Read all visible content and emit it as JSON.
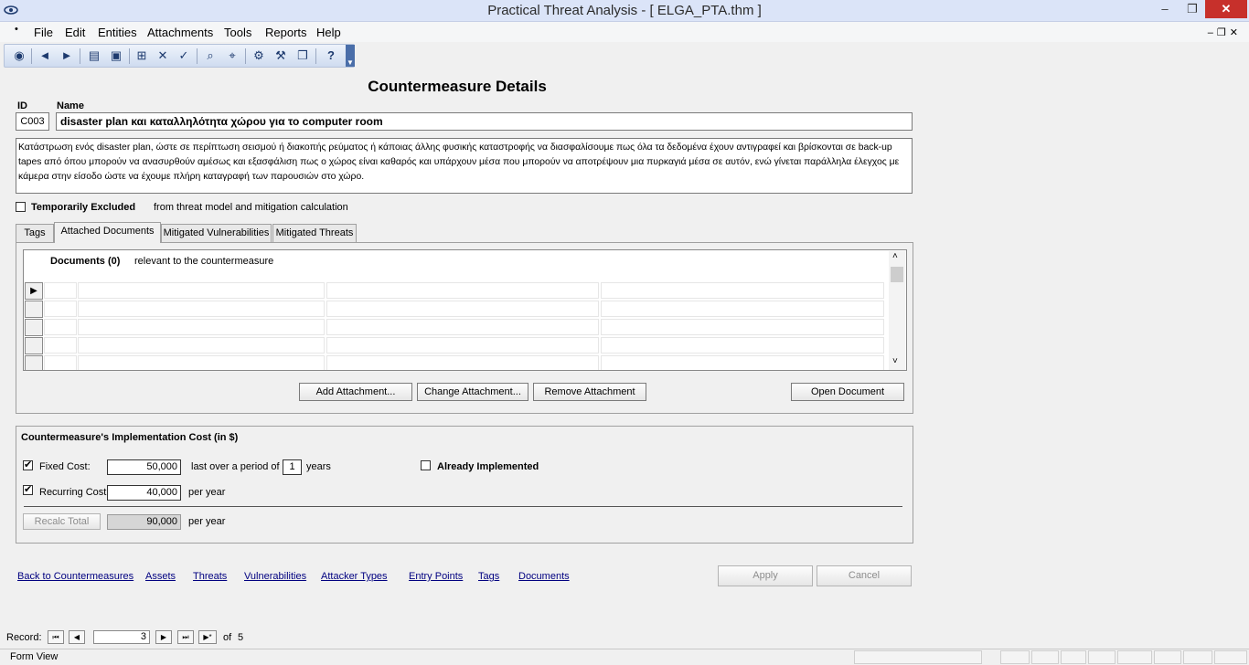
{
  "window": {
    "title": "Practical Threat Analysis - [ ELGA_PTA.thm ]",
    "minimize": "–",
    "maximize": "❐",
    "close": "✕"
  },
  "menu": {
    "grip": "•",
    "items": [
      "File",
      "Edit",
      "Entities",
      "Attachments",
      "Tools",
      "Reports",
      "Help"
    ],
    "mdi_buttons": "–❐✕"
  },
  "toolbar": {
    "icons": [
      "eye-icon",
      "back-icon",
      "forward-icon",
      "open-icon",
      "save-icon",
      "new-icon",
      "delete-icon",
      "spellcheck-icon",
      "find-icon",
      "find-replace-icon",
      "properties-icon",
      "tools-icon",
      "copy-icon",
      "help-icon"
    ]
  },
  "form": {
    "title": "Countermeasure Details",
    "id_label": "ID",
    "name_label": "Name",
    "id_value": "C003",
    "name_value": "disaster plan και καταλληλότητα χώρου για το  computer room",
    "description": "Κατάστρωση ενός disaster plan, ώστε σε περίπτωση σεισμού ή διακοπής ρεύματος ή κάποιας άλλης φυσικής καταστροφής να διασφαλίσουμε πως όλα τα δεδομένα έχουν αντιγραφεί και βρίσκονται σε back-up tapes από όπου μπορούν να ανασυρθούν αμέσως και εξασφάλιση πως ο χώρος είναι καθαρός και  υπάρχουν μέσα που μπορούν να αποτρέψουν μια πυρκαγιά μέσα σε αυτόν, ενώ γίνεται παράλληλα έλεγχος με κάμερα στην είσοδο ώστε να έχουμε πλήρη καταγραφή των παρουσιών στο χώρο.",
    "temporarily_excluded_label": "Temporarily Excluded",
    "temporarily_excluded_note": "from threat model and mitigation calculation",
    "temporarily_excluded_checked": false
  },
  "tabs": [
    {
      "label": "Tags",
      "active": false
    },
    {
      "label": "Attached Documents",
      "active": true
    },
    {
      "label": "Mitigated Vulnerabilities",
      "active": false
    },
    {
      "label": "Mitigated Threats",
      "active": false
    }
  ],
  "documents": {
    "heading": "Documents (0)",
    "subheading": "relevant to the countermeasure",
    "current_row_marker": "▶",
    "buttons": {
      "add": "Add Attachment...",
      "change": "Change Attachment...",
      "remove": "Remove Attachment",
      "open": "Open Document"
    },
    "scroll_up": "˄",
    "scroll_down": "˅"
  },
  "cost": {
    "title": "Countermeasure's Implementation Cost (in $)",
    "fixed_label": "Fixed Cost:",
    "fixed_checked": true,
    "fixed_value": "50,000",
    "period_prefix": "last over a period of",
    "period_value": "1",
    "period_suffix": "years",
    "already_implemented_label": "Already Implemented",
    "already_implemented_checked": false,
    "recurring_label": "Recurring Cost",
    "recurring_checked": true,
    "recurring_value": "40,000",
    "recurring_suffix": "per year",
    "recalc_label": "Recalc Total",
    "total_value": "90,000",
    "total_suffix": "per year",
    "check_mark": "✔"
  },
  "links": [
    "Back to Countermeasures",
    "Assets",
    "Threats",
    "Vulnerabilities",
    "Attacker Types",
    "Entry Points",
    "Tags",
    "Documents"
  ],
  "actions": {
    "apply": "Apply",
    "cancel": "Cancel"
  },
  "record_nav": {
    "label": "Record:",
    "first": "⏮",
    "prev": "◀",
    "next": "▶",
    "last": "⏭",
    "new": "▶*",
    "current": "3",
    "of_label": "of",
    "total": "5"
  },
  "status": {
    "view": "Form View"
  },
  "colors": {
    "link": "#000080",
    "close_button": "#c7302b",
    "titlebar": "#dbe4f8"
  }
}
